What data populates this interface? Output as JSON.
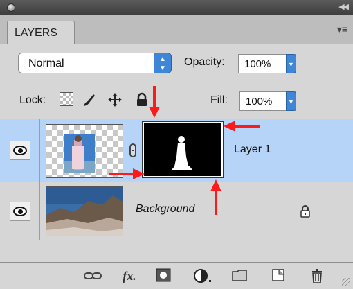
{
  "panel": {
    "tab_label": "LAYERS",
    "blend_mode": "Normal",
    "opacity_label": "Opacity:",
    "opacity_value": "100%",
    "lock_label": "Lock:",
    "fill_label": "Fill:",
    "fill_value": "100%"
  },
  "layers": [
    {
      "name": "Layer 1",
      "selected": true,
      "visible": true,
      "has_mask": true
    },
    {
      "name": "Background",
      "selected": false,
      "visible": true,
      "locked": true
    }
  ],
  "footer_icons": [
    "link-layers-icon",
    "layer-style-fx-icon",
    "add-mask-icon",
    "adjustment-layer-icon",
    "new-group-icon",
    "new-layer-icon",
    "delete-layer-icon"
  ],
  "colors": {
    "selection": "#b6d4f7",
    "accent_blue": "#3d86d8",
    "annotation_red": "#ff1a1a"
  }
}
